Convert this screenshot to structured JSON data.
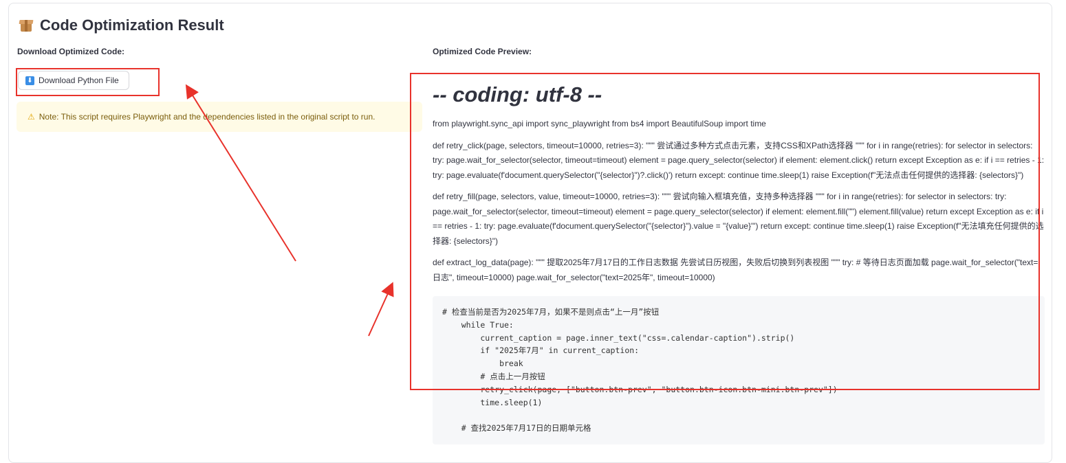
{
  "header": {
    "title": "Code Optimization Result",
    "icon": "package-icon"
  },
  "left": {
    "label": "Download Optimized Code:",
    "download_button": {
      "label": "Download Python File",
      "icon": "download-arrow-icon"
    },
    "note": {
      "icon": "warning-icon",
      "text": "Note: This script requires Playwright and the dependencies listed in the original script to run."
    }
  },
  "right": {
    "label": "Optimized Code Preview:",
    "heading": "-- coding: utf-8 --",
    "paragraphs": [
      "from playwright.sync_api import sync_playwright from bs4 import BeautifulSoup import time",
      "def retry_click(page, selectors, timeout=10000, retries=3): \"\"\" 尝试通过多种方式点击元素，支持CSS和XPath选择器 \"\"\" for i in range(retries): for selector in selectors: try: page.wait_for_selector(selector, timeout=timeout) element = page.query_selector(selector) if element: element.click() return except Exception as e: if i == retries - 1: try: page.evaluate(f'document.querySelector(\"{selector}\")?.click()') return except: continue time.sleep(1) raise Exception(f\"无法点击任何提供的选择器: {selectors}\")",
      "def retry_fill(page, selectors, value, timeout=10000, retries=3): \"\"\" 尝试向输入框填充值，支持多种选择器 \"\"\" for i in range(retries): for selector in selectors: try: page.wait_for_selector(selector, timeout=timeout) element = page.query_selector(selector) if element: element.fill(\"\") element.fill(value) return except Exception as e: if i == retries - 1: try: page.evaluate(f'document.querySelector(\"{selector}\").value = \"{value}\"') return except: continue time.sleep(1) raise Exception(f\"无法填充任何提供的选择器: {selectors}\")",
      "def extract_log_data(page): \"\"\" 提取2025年7月17日的工作日志数据 先尝试日历视图，失败后切换到列表视图 \"\"\" try: # 等待日志页面加载 page.wait_for_selector(\"text=日志\", timeout=10000) page.wait_for_selector(\"text=2025年\", timeout=10000)"
    ],
    "code_block": "# 检查当前是否为2025年7月，如果不是则点击“上一月”按钮\n    while True:\n        current_caption = page.inner_text(\"css=.calendar-caption\").strip()\n        if \"2025年7月\" in current_caption:\n            break\n        # 点击上一月按钮\n        retry_click(page, [\"button.btn-prev\", \"button.btn-icon.btn-mini.btn-prev\"])\n        time.sleep(1)\n\n    # 查找2025年7月17日的日期单元格"
  },
  "annotations": {
    "highlight_color": "#e8322b"
  }
}
